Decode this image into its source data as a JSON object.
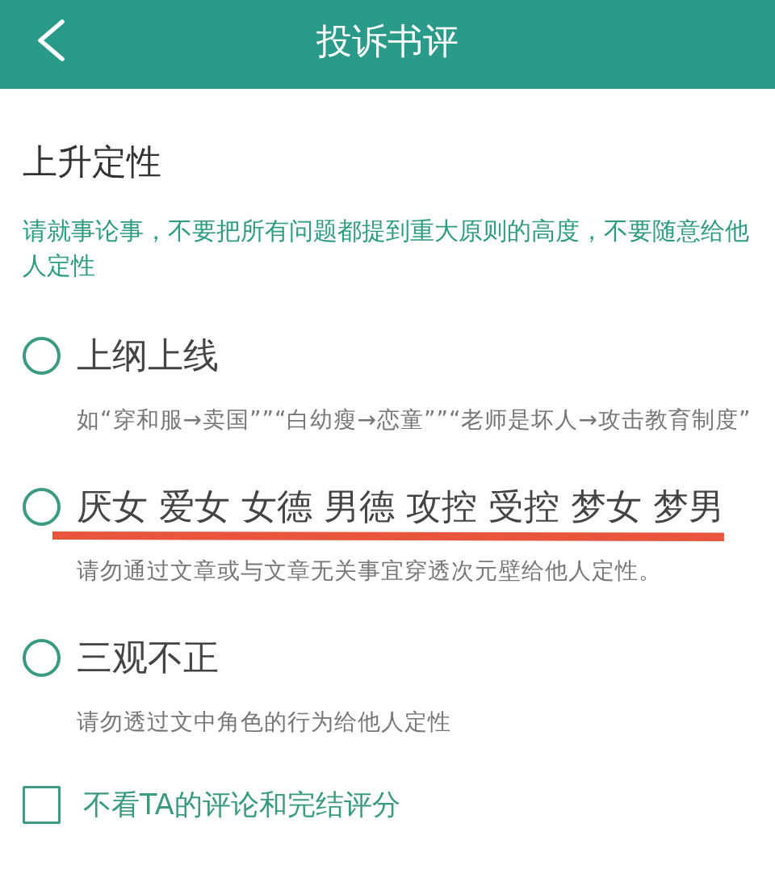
{
  "header": {
    "title": "投诉书评"
  },
  "section": {
    "title": "上升定性",
    "hint": "请就事论事，不要把所有问题都提到重大原则的高度，不要随意给他人定性"
  },
  "options": [
    {
      "label": "上纲上线",
      "description": "如“穿和服→卖国””“白幼瘦→恋童””“老师是坏人→攻击教育制度”",
      "selected": false,
      "underlined": false
    },
    {
      "label": "厌女 爱女 女德 男德 攻控 受控 梦女 梦男",
      "description": "请勿通过文章或与文章无关事宜穿透次元壁给他人定性。",
      "selected": false,
      "underlined": true
    },
    {
      "label": "三观不正",
      "description": "请勿透过文中角色的行为给他人定性",
      "selected": false,
      "underlined": false
    }
  ],
  "block_option": {
    "label": "不看TA的评论和完结评分",
    "checked": false
  }
}
